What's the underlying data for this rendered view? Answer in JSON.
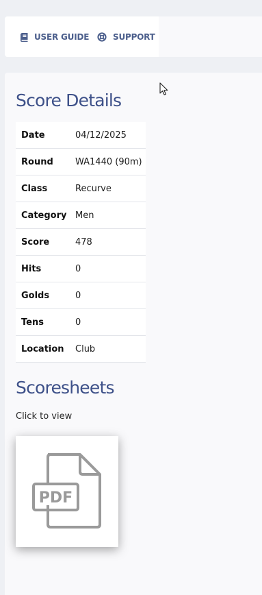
{
  "nav": {
    "user_guide_label": "USER GUIDE",
    "support_label": "SUPPORT",
    "user_guide_icon": "book-icon",
    "support_icon": "lifebuoy-icon"
  },
  "score_details": {
    "title": "Score Details",
    "rows": [
      {
        "key": "Date",
        "value": "04/12/2025"
      },
      {
        "key": "Round",
        "value": "WA1440 (90m)"
      },
      {
        "key": "Class",
        "value": "Recurve"
      },
      {
        "key": "Category",
        "value": "Men"
      },
      {
        "key": "Score",
        "value": "478"
      },
      {
        "key": "Hits",
        "value": "0"
      },
      {
        "key": "Golds",
        "value": "0"
      },
      {
        "key": "Tens",
        "value": "0"
      },
      {
        "key": "Location",
        "value": "Club"
      }
    ]
  },
  "scoresheets": {
    "title": "Scoresheets",
    "hint": "Click to view",
    "thumbnail_icon": "pdf-file-icon",
    "thumbnail_label": "PDF"
  },
  "colors": {
    "accent": "#3e5189",
    "nav_text": "#4c5f8c",
    "page_bg": "#eef0f4",
    "panel_bg": "#f9f9fb"
  }
}
